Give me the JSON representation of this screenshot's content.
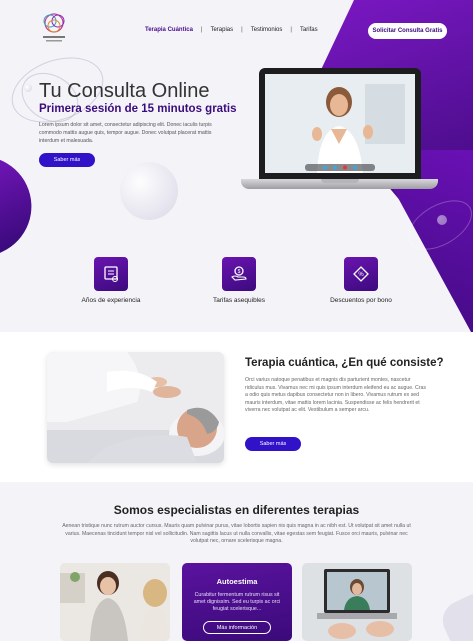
{
  "header": {
    "nav": [
      "Terapia Cuántica",
      "Terapias",
      "Testimonios",
      "Tarifas"
    ],
    "cta": "Solicitar Consulta Gratis"
  },
  "hero": {
    "title": "Tu Consulta Online",
    "subtitle": "Primera sesión de 15 minutos gratis",
    "text": "Lorem ipsum dolor sit amet, consectetur adipiscing elit. Donec iaculis turpis commodo mattis augue quis, tempor augue. Donec volutpat placerat mattis interdum et malesuada.",
    "button": "Saber más"
  },
  "features": [
    {
      "label": "Años de experiencia",
      "icon": "certificate-icon"
    },
    {
      "label": "Tarifas asequibles",
      "icon": "hand-coin-icon"
    },
    {
      "label": "Descuentos por bono",
      "icon": "discount-tag-icon"
    }
  ],
  "about": {
    "title": "Terapia cuántica, ¿En qué consiste?",
    "text": "Orci varius natoque penatibus et magnis dis parturient montes, nascetur ridiculus mus. Vivamus nec mi quis ipsum interdum eleifend eu ac augue. Cras a odio quis metus dapibus consectetur non in libero. Vivamus rutrum ex sed mauris interdum, vitae mattis lorem lacinia. Suspendisse ac felis hendrerit et viverra nec volutpat ac elit. Vestibulum a semper arcu.",
    "button": "Saber más"
  },
  "therapies": {
    "title": "Somos especialistas en diferentes terapias",
    "text": "Aenean tristique nunc rutrum auctor cursus. Mauris quam pulvinar purus, vitae lobortis sapien nis quis magna in ac nibh est. Ut volutpat sit amet nulla ut varius. Maecenas tincidunt tempor nisl vel sollicitudin. Nam sagittis lacus ut nulla convallis, vitae egestas sem feugiat. Fusce orci mauris, pulvinar nec volutpat nec, ornare scelerisque magna.",
    "featured_card": {
      "title": "Autoestima",
      "text": "Curabitur fermentum rutrum risus sit amet dignissim. Sed eu turpis ac orci feugiat scelerisque...",
      "button": "Más información"
    }
  },
  "colors": {
    "accent": "#3112c9",
    "brand_purple": "#4a0e8c"
  }
}
